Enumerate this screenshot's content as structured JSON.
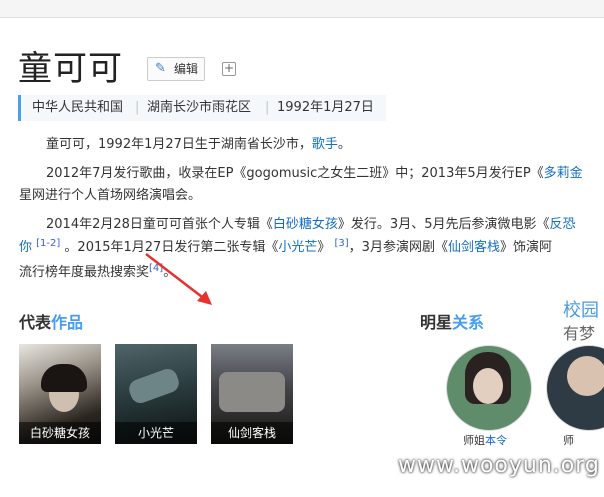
{
  "header": {
    "title": "童可可",
    "edit_label": "编辑",
    "plus_symbol": "+"
  },
  "info": {
    "country": "中华人民共和国",
    "district": "湖南长沙市雨花区",
    "birth": "1992年1月27日"
  },
  "intro": {
    "prefix": "童可可，1992年1月27日生于湖南省长沙市，",
    "link": "歌手",
    "suffix": "。"
  },
  "p2": {
    "line1_a": "2012年7月发行歌曲，收录在EP《gogomusic之女生二班》中；2013年5月发行EP《",
    "line1_link": "多莉金",
    "line2": "星网进行个人首场网络演唱会。"
  },
  "p3": {
    "l1_a": "2014年2月28日童可可首张个人专辑《",
    "l1_link1": "白砂糖女孩",
    "l1_b": "》发行。3月、5月先后参演微电影《",
    "l1_link2": "反恐",
    "l2_link0": "你",
    "l2_sup1": "[1-2]",
    "l2_a": " 。2015年1月27日发行第二张专辑《",
    "l2_link1": "小光芒",
    "l2_b": "》",
    "l2_sup2": "[3]",
    "l2_c": "，3月参演网剧《",
    "l2_link2": "仙剑客栈",
    "l2_d": "》饰演阿",
    "l3_a": "流行榜年度最热搜索奖",
    "l3_sup": "[4]",
    "l3_b": "。"
  },
  "works": {
    "title_a": "代表",
    "title_b": "作品",
    "items": [
      {
        "label": "白砂糖女孩"
      },
      {
        "label": "小光芒"
      },
      {
        "label": "仙剑客栈"
      }
    ]
  },
  "stars": {
    "title_a": "明星",
    "title_b": "关系",
    "item1_name": "师姐",
    "item1_link": "本令",
    "item2_name": "师"
  },
  "campus": {
    "title": "校园",
    "sub": "有梦"
  },
  "watermark": "www.wooyun.org",
  "colors": {
    "accent": "#459df5",
    "link": "#136ec2",
    "arrow": "#e8312f",
    "info_border": "#4aa3df"
  }
}
